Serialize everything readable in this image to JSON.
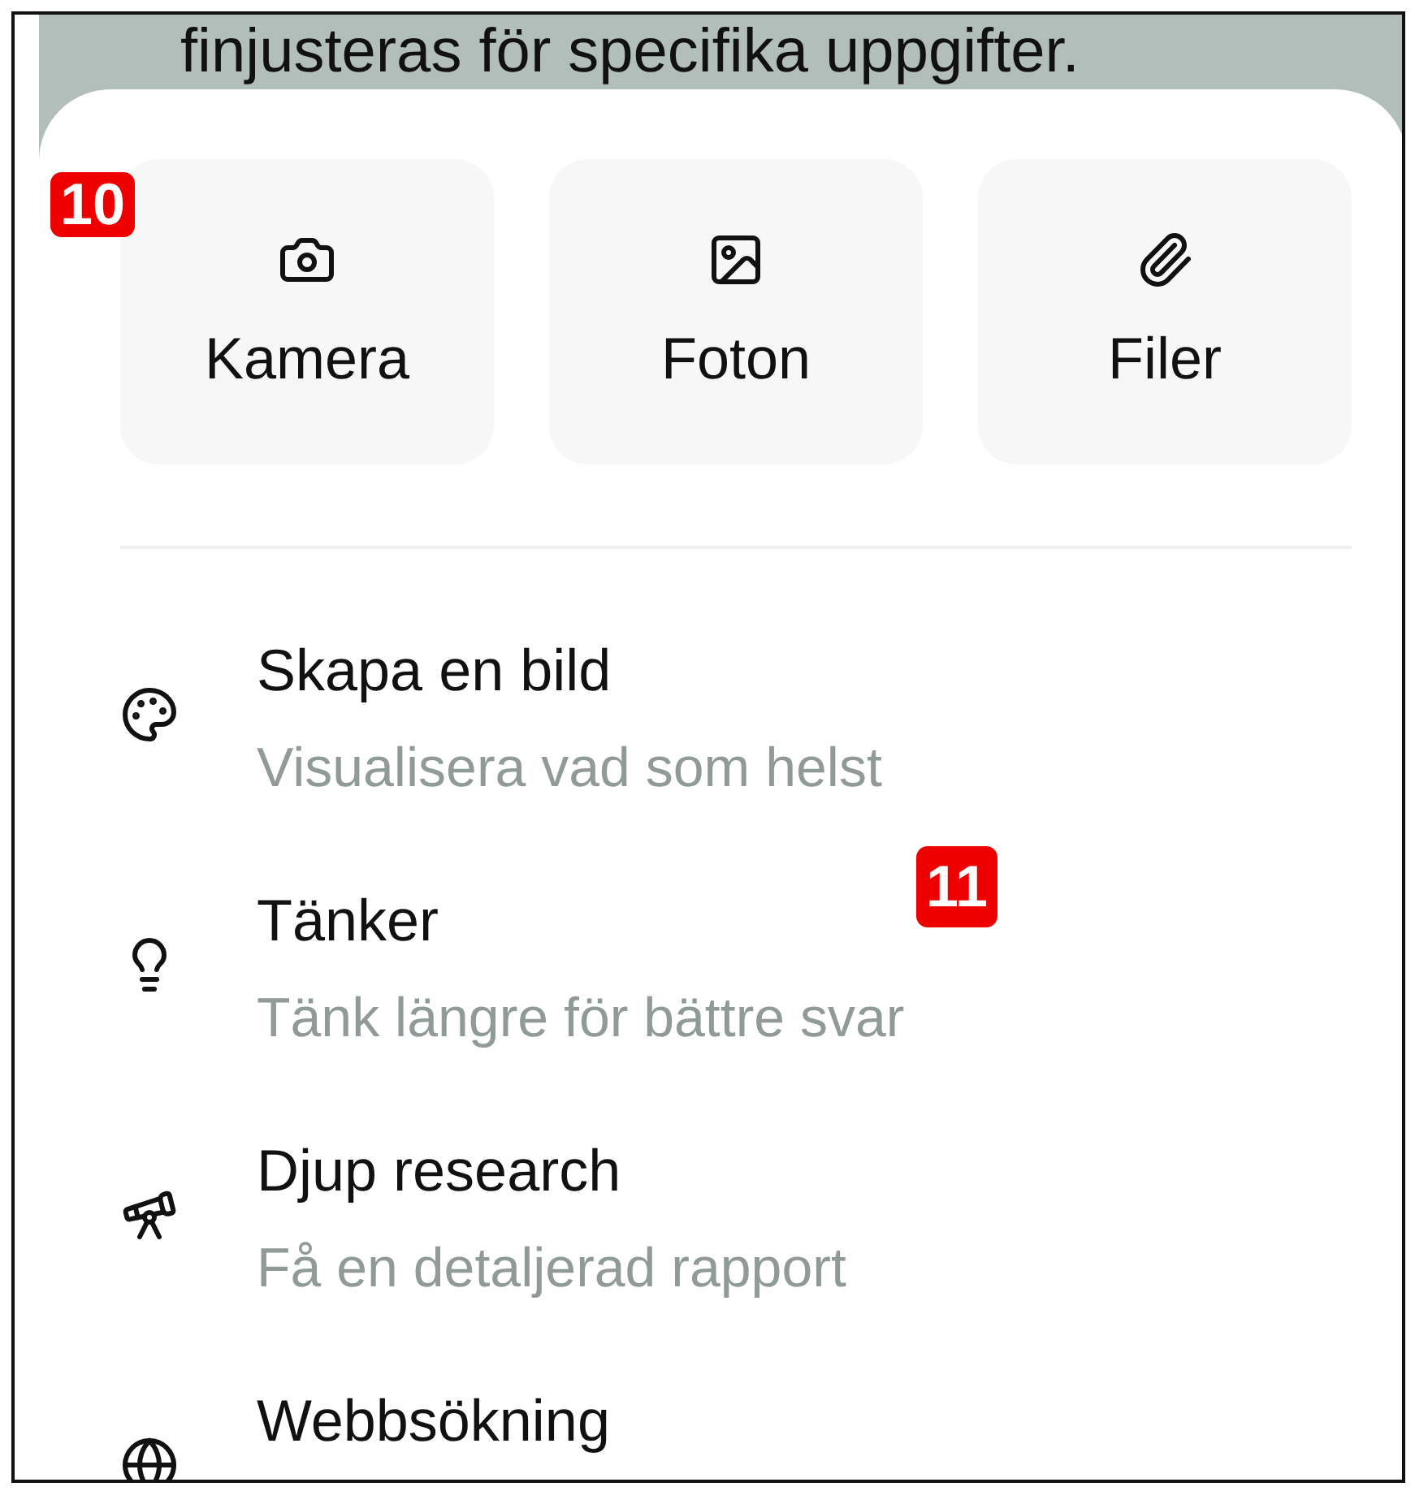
{
  "background_text": "finjusteras för specifika uppgifter.",
  "attach_options": [
    {
      "label": "Kamera"
    },
    {
      "label": "Foton"
    },
    {
      "label": "Filer"
    }
  ],
  "tools": [
    {
      "title": "Skapa en bild",
      "subtitle": "Visualisera vad som helst"
    },
    {
      "title": "Tänker",
      "subtitle": "Tänk längre för bättre svar"
    },
    {
      "title": "Djup research",
      "subtitle": "Få en detaljerad rapport"
    },
    {
      "title": "Webbsökning"
    }
  ],
  "badges": [
    "10",
    "11"
  ]
}
